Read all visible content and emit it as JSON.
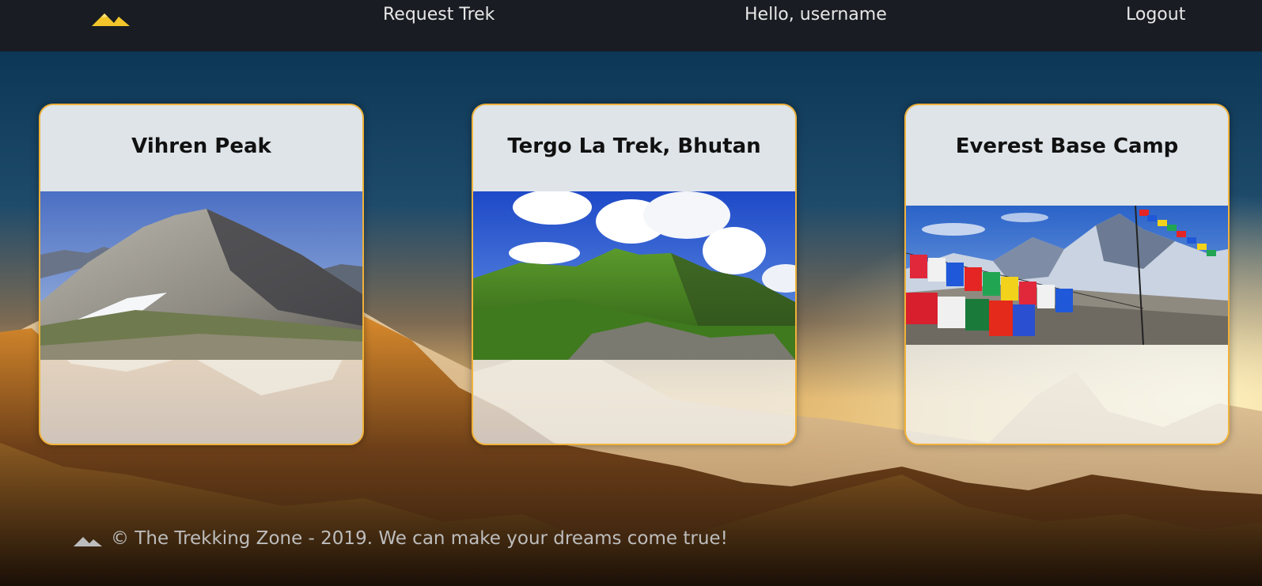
{
  "nav": {
    "logo_icon": "mountain-logo-icon",
    "request_label": "Request Trek",
    "greeting": "Hello, username",
    "logout_label": "Logout"
  },
  "treks": [
    {
      "title": "Vihren Peak",
      "image": "grey-mountain-peak"
    },
    {
      "title": "Tergo La Trek, Bhutan",
      "image": "green-hills-clouds"
    },
    {
      "title": "Everest Base Camp",
      "image": "prayer-flags-snow-peaks"
    }
  ],
  "footer": {
    "icon": "mountain-icon",
    "text": "© The Trekking Zone - 2019. We can make your dreams come true!"
  },
  "colors": {
    "nav_bg": "#191c22",
    "accent": "#f0b23a",
    "logo": "#f2c52b",
    "card_head": "#dfe4e8"
  }
}
